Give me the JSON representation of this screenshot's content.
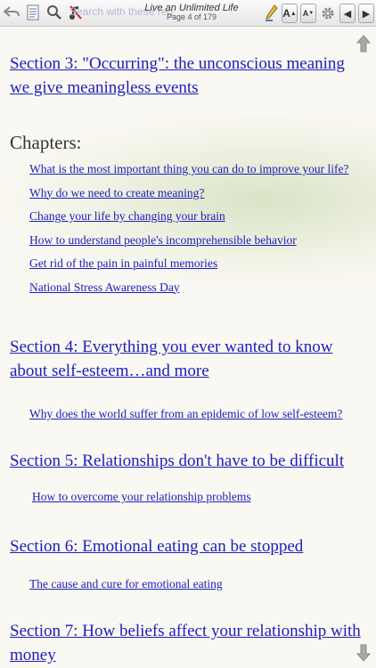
{
  "toolbar": {
    "search_placeholder": "Search with these reg",
    "title": "Live an Unlimited Life",
    "page_indicator": "Page 4 of 179",
    "font_larger": "A",
    "font_smaller": "A"
  },
  "sections": [
    {
      "title": "Section 3: \"Occurring\":  the unconscious meaning we give meaningless events",
      "chapters_label": "Chapters:",
      "chapters": [
        "What is the most important thing you can do to improve your life?",
        "Why do we need to create meaning?",
        "Change your life by changing your brain",
        "How to understand people's incomprehensible behavior",
        "Get rid of the pain in painful memories",
        "National Stress Awareness Day"
      ]
    },
    {
      "title": "Section 4: Everything you ever wanted to know about self-esteem…and more",
      "chapters": [
        "Why does the world suffer from an epidemic of low self-esteem?"
      ]
    },
    {
      "title": "Section 5: Relationships don't have to be difficult",
      "chapters": [
        "How to overcome your relationship problems"
      ]
    },
    {
      "title": "Section 6:  Emotional eating can be stopped",
      "chapters": [
        "The cause and cure for emotional eating"
      ]
    },
    {
      "title": "Section 7:  How beliefs affect your relationship with money",
      "chapters": []
    }
  ],
  "colors": {
    "link": "#1d1dbd",
    "toolbar_icon": "#666666",
    "scroll_arrow": "#9a9a9a"
  }
}
